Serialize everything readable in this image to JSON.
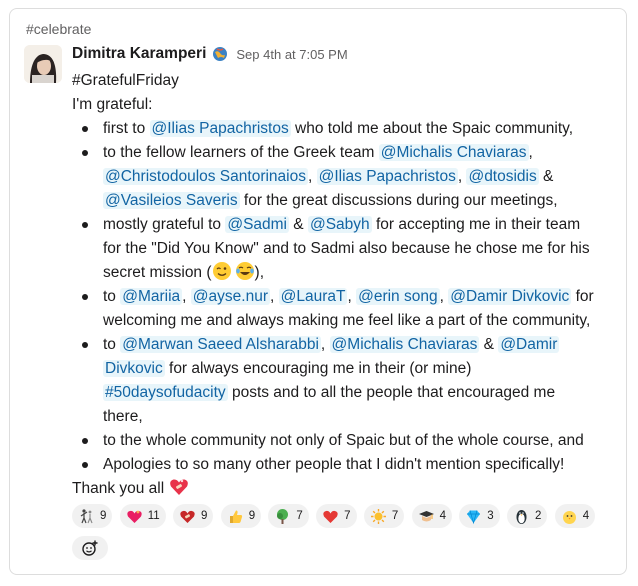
{
  "channel": "#celebrate",
  "message": {
    "author": "Dimitra Karamperi",
    "timestamp": "Sep 4th at 7:05 PM",
    "heading": "#GratefulFriday",
    "intro": "I'm grateful:",
    "closing": "Thank you all",
    "bullets": {
      "b1": {
        "pre": "first to ",
        "m1": "@Ilias Papachristos",
        "post": " who told me about the Spaic community,"
      },
      "b2": {
        "pre": "to the fellow learners of the Greek team ",
        "m1": "@Michalis Chaviaras",
        "s1": ",",
        "m2": "@Christodoulos Santorinaios",
        "s2": ", ",
        "m3": "@Ilias Papachristos",
        "s3": ", ",
        "m4": "@dtosidis",
        "s4": " &",
        "m5": "@Vasileios Saveris",
        "post": " for the great discussions during our meetings,"
      },
      "b3": {
        "pre": "mostly grateful to ",
        "m1": "@Sadmi",
        "s1": " & ",
        "m2": "@Sabyh",
        "post1": " for accepting me in their team",
        "line2": "for the \"Did You Know\" and to Sadmi also because he chose me for his",
        "line3_pre": "secret mission (",
        "line3_post": "),"
      },
      "b4": {
        "pre": "to ",
        "m1": "@Mariia",
        "s1": ", ",
        "m2": "@ayse.nur",
        "s2": ", ",
        "m3": "@LauraT",
        "s3": ", ",
        "m4": "@erin song",
        "s4": ", ",
        "m5": "@Damir Divkovic",
        "post1": " for",
        "line2": "welcoming me and always making me feel like a part of the community,"
      },
      "b5": {
        "pre": "to ",
        "m1": "@Marwan Saeed Alsharabbi",
        "s1": ", ",
        "m2": "@Michalis Chaviaras",
        "s2": " & ",
        "m3a": "@Damir",
        "m3b": "Divkovic",
        "post1": " for always encouraging me in their (or mine)",
        "hashtag": "#50daysofudacity",
        "post2": " posts and to all the people that encouraged me",
        "line4": "there,"
      },
      "b6": {
        "text": "to the whole community not only of Spaic but of the whole course, and"
      },
      "b7": {
        "text": "Apologies to so many other people that I didn't mention specifically!"
      }
    }
  },
  "reactions": [
    {
      "icon": "dancers-icon",
      "count": "9"
    },
    {
      "icon": "sparkling-heart-icon",
      "count": "11"
    },
    {
      "icon": "heart-bandaged-icon",
      "count": "9"
    },
    {
      "icon": "thumbs-up-icon",
      "count": "9"
    },
    {
      "icon": "tree-icon",
      "count": "7"
    },
    {
      "icon": "red-heart-icon",
      "count": "7"
    },
    {
      "icon": "sun-icon",
      "count": "7"
    },
    {
      "icon": "graduate-icon",
      "count": "4"
    },
    {
      "icon": "gem-icon",
      "count": "3"
    },
    {
      "icon": "penguin-icon",
      "count": "2"
    },
    {
      "icon": "chick-icon",
      "count": "4"
    }
  ],
  "colors": {
    "mention": "#1264a3",
    "mention_bg": "#e8f5fa",
    "reaction_bg": "#f1f1f1",
    "muted": "#616061"
  }
}
